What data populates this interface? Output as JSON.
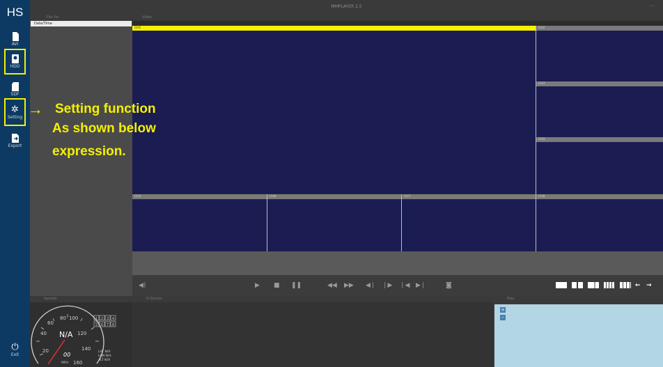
{
  "window": {
    "title": "MMPLAYER 2.5",
    "minimize": "—"
  },
  "sidebar": {
    "logo": "HS",
    "items": [
      {
        "label": "AVI"
      },
      {
        "label": "HDD"
      },
      {
        "label": "SDF"
      },
      {
        "label": "Setting"
      },
      {
        "label": "Export"
      }
    ],
    "exit_label": "Exit"
  },
  "file_panel": {
    "header": "File list",
    "column": "Date/Time"
  },
  "video": {
    "header": "Video",
    "channels": [
      "CH1",
      "CH2",
      "CH3",
      "CH4",
      "CH5",
      "CH6",
      "CH7",
      "CH8"
    ]
  },
  "bottom": {
    "speed_header": "Speedo",
    "gsensor_header": "G-Sensor",
    "map_header": "Map",
    "map_zoom_in": "+",
    "map_zoom_out": "-"
  },
  "speedometer": {
    "ticks": [
      "20",
      "40",
      "60",
      "80",
      "100",
      "120",
      "140",
      "160"
    ],
    "value": "N/A",
    "digits": "00",
    "unit": "MPH",
    "lat": "LAT N/A",
    "lon": "LON N/A",
    "alt": "ALT N/A",
    "channel_boxes": [
      "1",
      "2",
      "3",
      "4",
      "5",
      "6",
      "7",
      "8"
    ]
  },
  "annotation": {
    "arrow": "→",
    "line1": "Setting function",
    "line2": "As shown below",
    "line3": "expression."
  },
  "colors": {
    "sidebar": "#0d3a63",
    "video_bg": "#1a1c52",
    "highlight": "#f5f000",
    "map": "#b3d6e4"
  }
}
